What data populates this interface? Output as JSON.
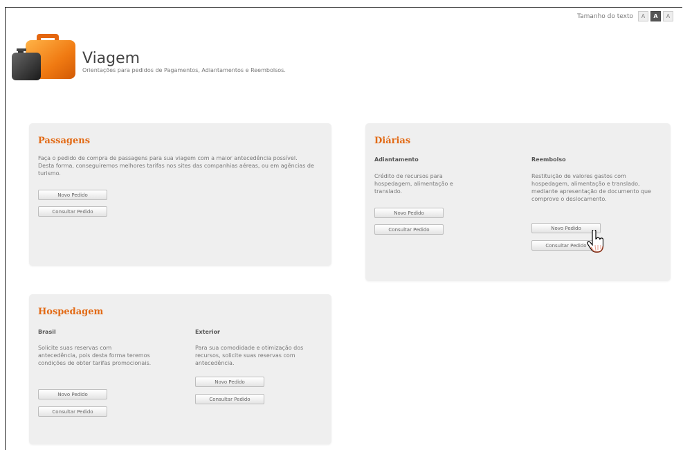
{
  "text_size": {
    "label": "Tamanho do texto",
    "small": "A",
    "medium": "A",
    "large": "A"
  },
  "header": {
    "title": "Viagem",
    "subtitle": "Orientações para pedidos de Pagamentos, Adiantamentos e Reembolsos."
  },
  "passagens": {
    "title": "Passagens",
    "text": "Faça o pedido de compra de passagens para sua viagem com a maior antecedência possível. Desta forma, conseguiremos melhores tarifas nos sites das companhias aéreas, ou em agências de turismo.",
    "new_label": "Novo Pedido",
    "consult_label": "Consultar Pedido"
  },
  "diarias": {
    "title": "Diárias",
    "adiantamento": {
      "heading": "Adiantamento",
      "text": "Crédito de recursos para hospedagem, alimentação e translado.",
      "new_label": "Novo Pedido",
      "consult_label": "Consultar Pedido"
    },
    "reembolso": {
      "heading": "Reembolso",
      "text": "Restituição de valores gastos com hospedagem, alimentação e translado, mediante apresentação de documento que comprove o deslocamento.",
      "new_label": "Novo Pedido",
      "consult_label": "Consultar Pedido"
    }
  },
  "hospedagem": {
    "title": "Hospedagem",
    "brasil": {
      "heading": "Brasil",
      "text": "Solicite suas reservas com antecedência, pois desta forma teremos condições de obter tarifas promocionais.",
      "new_label": "Novo Pedido",
      "consult_label": "Consultar Pedido"
    },
    "exterior": {
      "heading": "Exterior",
      "text": "Para sua comodidade e otimização dos recursos, solicite suas reservas com antecedência.",
      "new_label": "Novo Pedido",
      "consult_label": "Consultar Pedido"
    }
  },
  "colors": {
    "accent": "#e26a15",
    "card_bg": "#efefef"
  },
  "icons": {
    "logo": "suitcase-icon",
    "cursor": "hand-pointer-icon"
  }
}
